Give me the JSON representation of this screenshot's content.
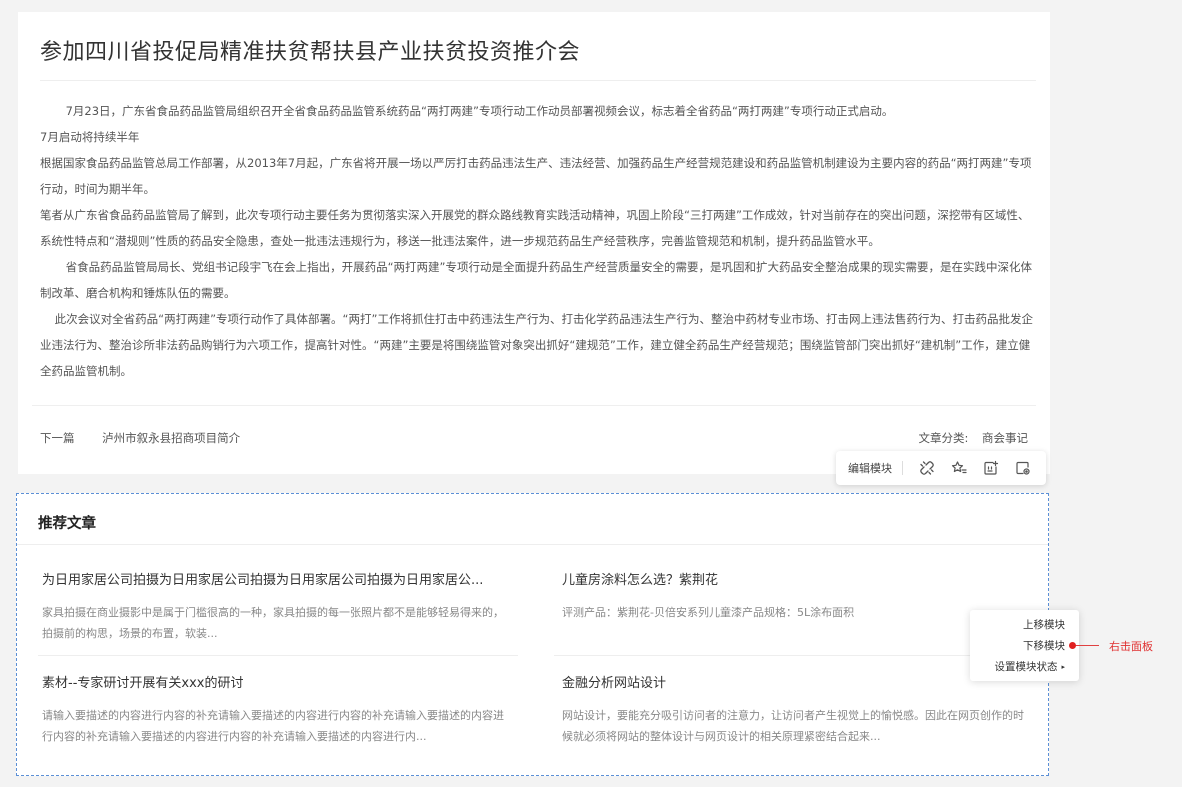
{
  "article": {
    "title": "参加四川省投促局精准扶贫帮扶县产业扶贫投资推介会",
    "paragraphs": [
      "       7月23日，广东省食品药品监管局组织召开全省食品药品监管系统药品“两打两建”专项行动工作动员部署视频会议，标志着全省药品“两打两建”专项行动正式启动。",
      "7月启动将持续半年",
      "根据国家食品药品监管总局工作部署，从2013年7月起，广东省将开展一场以严厉打击药品违法生产、违法经营、加强药品生产经营规范建设和药品监管机制建设为主要内容的药品“两打两建”专项行动，时间为期半年。",
      "笔者从广东省食品药品监管局了解到，此次专项行动主要任务为贯彻落实深入开展党的群众路线教育实践活动精神，巩固上阶段“三打两建”工作成效，针对当前存在的突出问题，深挖带有区域性、系统性特点和“潜规则”性质的药品安全隐患，查处一批违法违规行为，移送一批违法案件，进一步规范药品生产经营秩序，完善监管规范和机制，提升药品监管水平。",
      "       省食品药品监管局局长、党组书记段宇飞在会上指出，开展药品“两打两建”专项行动是全面提升药品生产经营质量安全的需要，是巩固和扩大药品安全整治成果的现实需要，是在实践中深化体制改革、磨合机构和锤炼队伍的需要。",
      "    此次会议对全省药品“两打两建”专项行动作了具体部署。“两打”工作将抓住打击中药违法生产行为、打击化学药品违法生产行为、整治中药材专业市场、打击网上违法售药行为、打击药品批发企业违法行为、整治诊所非法药品购销行为六项工作，提高针对性。“两建”主要是将围绕监管对象突出抓好“建规范”工作，建立健全药品生产经营规范；围绕监管部门突出抓好“建机制”工作，建立健全药品监管机制。"
    ],
    "next_label": "下一篇",
    "next_title": "泸州市叙永县招商项目简介",
    "category_label": "文章分类:",
    "category_value": "商会事记"
  },
  "toolbar": {
    "edit_label": "编辑模块",
    "icons": [
      "unlink-icon",
      "star-list-icon",
      "add-module-icon",
      "module-settings-icon"
    ]
  },
  "recommend": {
    "title": "推荐文章",
    "items": [
      {
        "title": "为日用家居公司拍摄为日用家居公司拍摄为日用家居公司拍摄为日用家居公...",
        "desc": "家具拍摄在商业摄影中是属于门槛很高的一种，家具拍摄的每一张照片都不是能够轻易得来的，拍摄前的构思，场景的布置，软装..."
      },
      {
        "title": "儿童房涂料怎么选？紫荆花",
        "desc": "评测产品：紫荆花-贝倍安系列儿童漆产品规格：5L涂布面积"
      },
      {
        "title": "素材--专家研讨开展有关xxx的研讨",
        "desc": "请输入要描述的内容进行内容的补充请输入要描述的内容进行内容的补充请输入要描述的内容进行内容的补充请输入要描述的内容进行内容的补充请输入要描述的内容进行内..."
      },
      {
        "title": "金融分析网站设计",
        "desc": "网站设计，要能充分吸引访问者的注意力，让访问者产生视觉上的愉悦感。因此在网页创作的时候就必须将网站的整体设计与网页设计的相关原理紧密结合起来..."
      }
    ]
  },
  "context_menu": {
    "items": [
      "上移模块",
      "下移模块",
      "设置模块状态"
    ],
    "submenu_caret": "▸"
  },
  "annotation": {
    "label": "右击面板",
    "color": "#e03030"
  },
  "colors": {
    "module_border": "#5b8fd6",
    "background": "#f3f3f3"
  }
}
